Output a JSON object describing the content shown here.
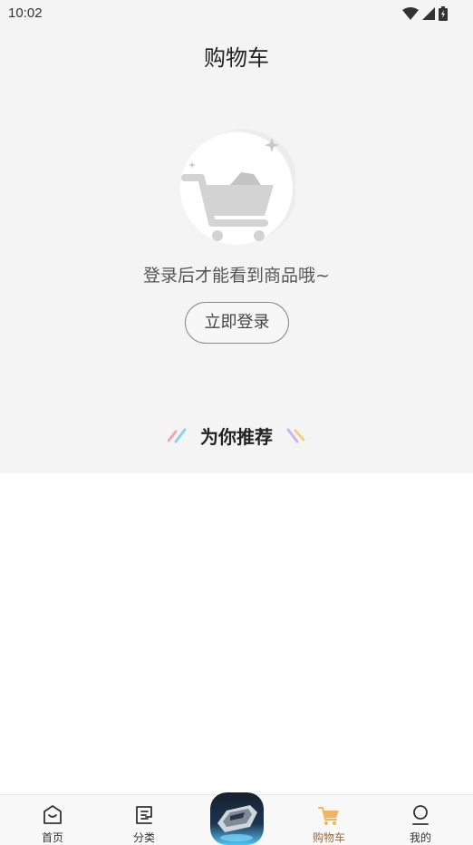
{
  "status_bar": {
    "time": "10:02",
    "icons": [
      "wifi-icon",
      "signal-icon",
      "battery-icon"
    ]
  },
  "header": {
    "title": "购物车"
  },
  "empty_state": {
    "illustration": "empty-cart-icon",
    "message": "登录后才能看到商品哦~",
    "login_label": "立即登录"
  },
  "recommend": {
    "title": "为你推荐"
  },
  "tab_bar": {
    "items": [
      {
        "label": "首页",
        "icon": "home-icon"
      },
      {
        "label": "分类",
        "icon": "category-icon"
      },
      {
        "label": "",
        "icon": "center-app-icon"
      },
      {
        "label": "购物车",
        "icon": "cart-icon",
        "active": true
      },
      {
        "label": "我的",
        "icon": "profile-icon"
      }
    ]
  },
  "colors": {
    "page_background": "#f4f4f4",
    "active_tab": "#9a6a3a",
    "cart_icon": "#f5b35e"
  }
}
